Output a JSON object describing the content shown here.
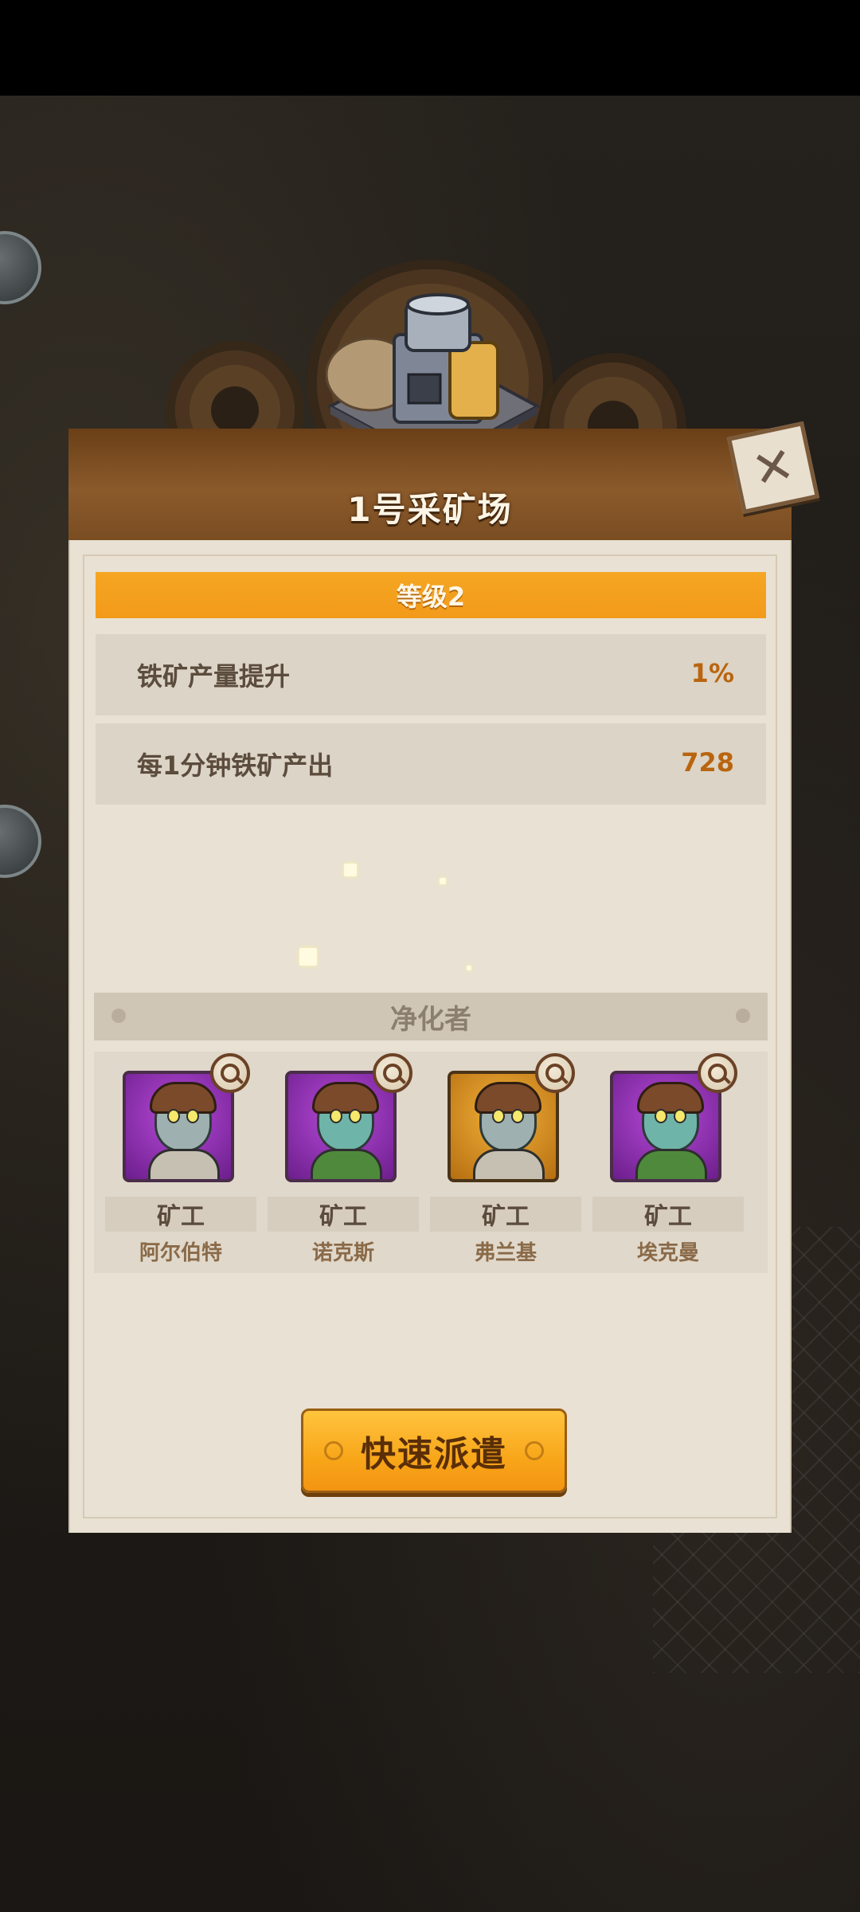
{
  "building": {
    "title": "1号采矿场",
    "level_label": "等级2"
  },
  "stats": [
    {
      "label": "铁矿产量提升",
      "value": "1%"
    },
    {
      "label": "每1分钟铁矿产出",
      "value": "728"
    }
  ],
  "section": {
    "title": "净化者"
  },
  "workers": [
    {
      "role": "矿工",
      "name": "阿尔伯特",
      "frame": "purple",
      "look": "bandaged"
    },
    {
      "role": "矿工",
      "name": "诺克斯",
      "frame": "purple",
      "look": "green"
    },
    {
      "role": "矿工",
      "name": "弗兰基",
      "frame": "gold",
      "look": "bandaged"
    },
    {
      "role": "矿工",
      "name": "埃克曼",
      "frame": "purple",
      "look": "green"
    }
  ],
  "actions": {
    "dispatch_label": "快速派遣"
  },
  "icons": {
    "close": "close-icon",
    "inspect": "magnifier-icon"
  },
  "colors": {
    "accent_orange": "#f5a623",
    "value_text": "#b9650f",
    "header_brown": "#8b5a2b"
  }
}
